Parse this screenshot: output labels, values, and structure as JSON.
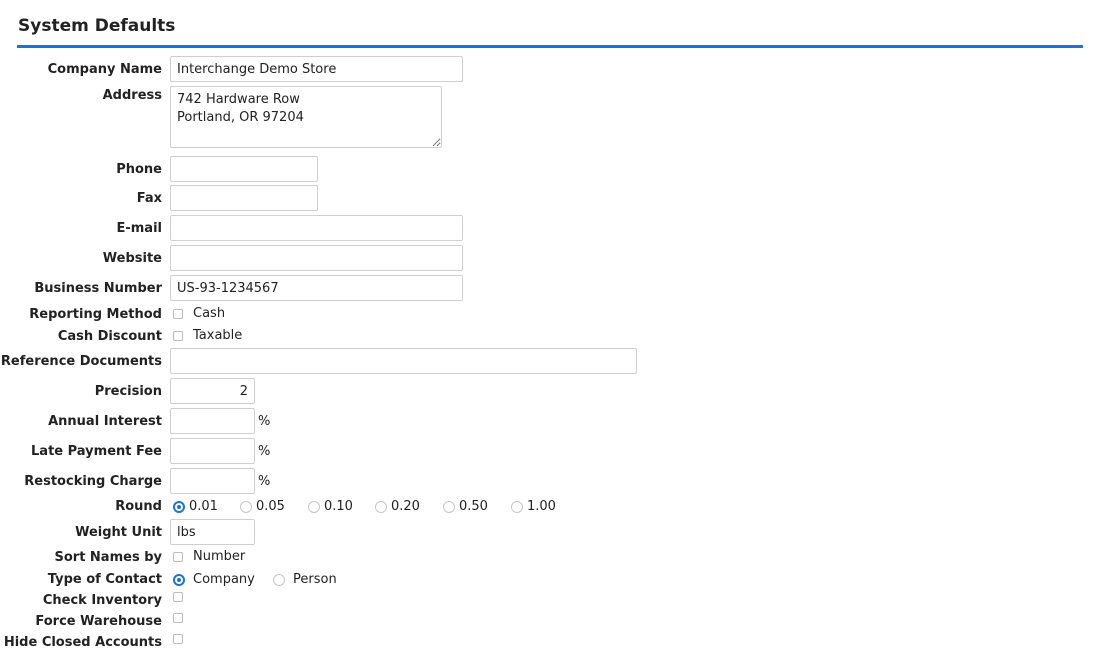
{
  "page": {
    "title": "System Defaults"
  },
  "colors": {
    "accent": "#1a73d9",
    "field_border": "#cfcfcf"
  },
  "form": {
    "company_name": {
      "label": "Company Name",
      "value": "Interchange Demo Store"
    },
    "address": {
      "label": "Address",
      "value": "742 Hardware Row\nPortland, OR 97204"
    },
    "phone": {
      "label": "Phone",
      "value": ""
    },
    "fax": {
      "label": "Fax",
      "value": ""
    },
    "email": {
      "label": "E-mail",
      "value": ""
    },
    "website": {
      "label": "Website",
      "value": ""
    },
    "business_number": {
      "label": "Business Number",
      "value": "US-93-1234567"
    },
    "reporting_method": {
      "label": "Reporting Method",
      "option": "Cash",
      "checked": false
    },
    "cash_discount": {
      "label": "Cash Discount",
      "option": "Taxable",
      "checked": false
    },
    "reference_documents": {
      "label": "Reference Documents",
      "value": ""
    },
    "precision": {
      "label": "Precision",
      "value": "2"
    },
    "annual_interest": {
      "label": "Annual Interest",
      "value": "",
      "unit": "%"
    },
    "late_payment_fee": {
      "label": "Late Payment Fee",
      "value": "",
      "unit": "%"
    },
    "restocking_charge": {
      "label": "Restocking Charge",
      "value": "",
      "unit": "%"
    },
    "round": {
      "label": "Round",
      "options": [
        "0.01",
        "0.05",
        "0.10",
        "0.20",
        "0.50",
        "1.00"
      ],
      "selected": "0.01"
    },
    "weight_unit": {
      "label": "Weight Unit",
      "value": "lbs"
    },
    "sort_names_by": {
      "label": "Sort Names by",
      "option": "Number",
      "checked": false
    },
    "type_of_contact": {
      "label": "Type of Contact",
      "options": [
        "Company",
        "Person"
      ],
      "selected": "Company"
    },
    "check_inventory": {
      "label": "Check Inventory",
      "checked": false
    },
    "force_warehouse": {
      "label": "Force Warehouse",
      "checked": false
    },
    "hide_closed_accounts": {
      "label": "Hide Closed Accounts",
      "checked": false
    }
  }
}
